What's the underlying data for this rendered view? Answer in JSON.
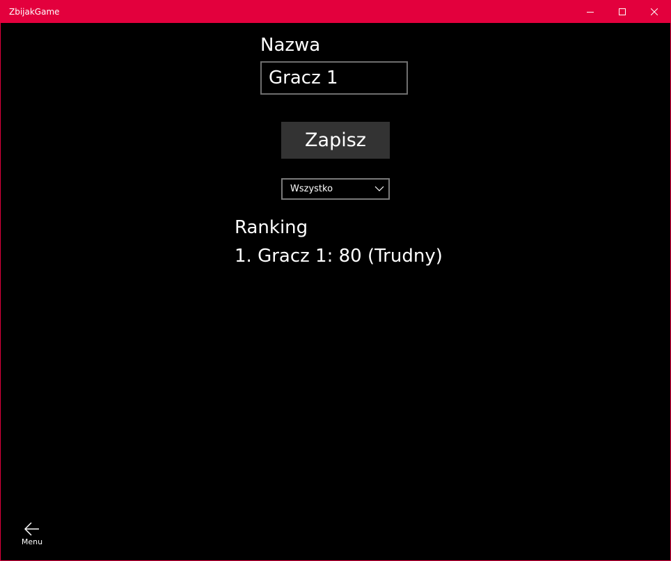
{
  "window": {
    "title": "ZbijakGame",
    "accent_color": "#e3003d",
    "controls": {
      "minimize_icon": "minimize-icon",
      "maximize_icon": "maximize-icon",
      "close_icon": "close-icon"
    }
  },
  "form": {
    "name_label": "Nazwa",
    "name_value": "Gracz 1",
    "save_label": "Zapisz"
  },
  "filter": {
    "selected": "Wszystko",
    "icon": "chevron-down-icon"
  },
  "ranking": {
    "title": "Ranking",
    "entries": [
      "1. Gracz 1: 80 (Trudny)"
    ]
  },
  "nav": {
    "back_icon": "arrow-left-icon",
    "menu_label": "Menu"
  }
}
